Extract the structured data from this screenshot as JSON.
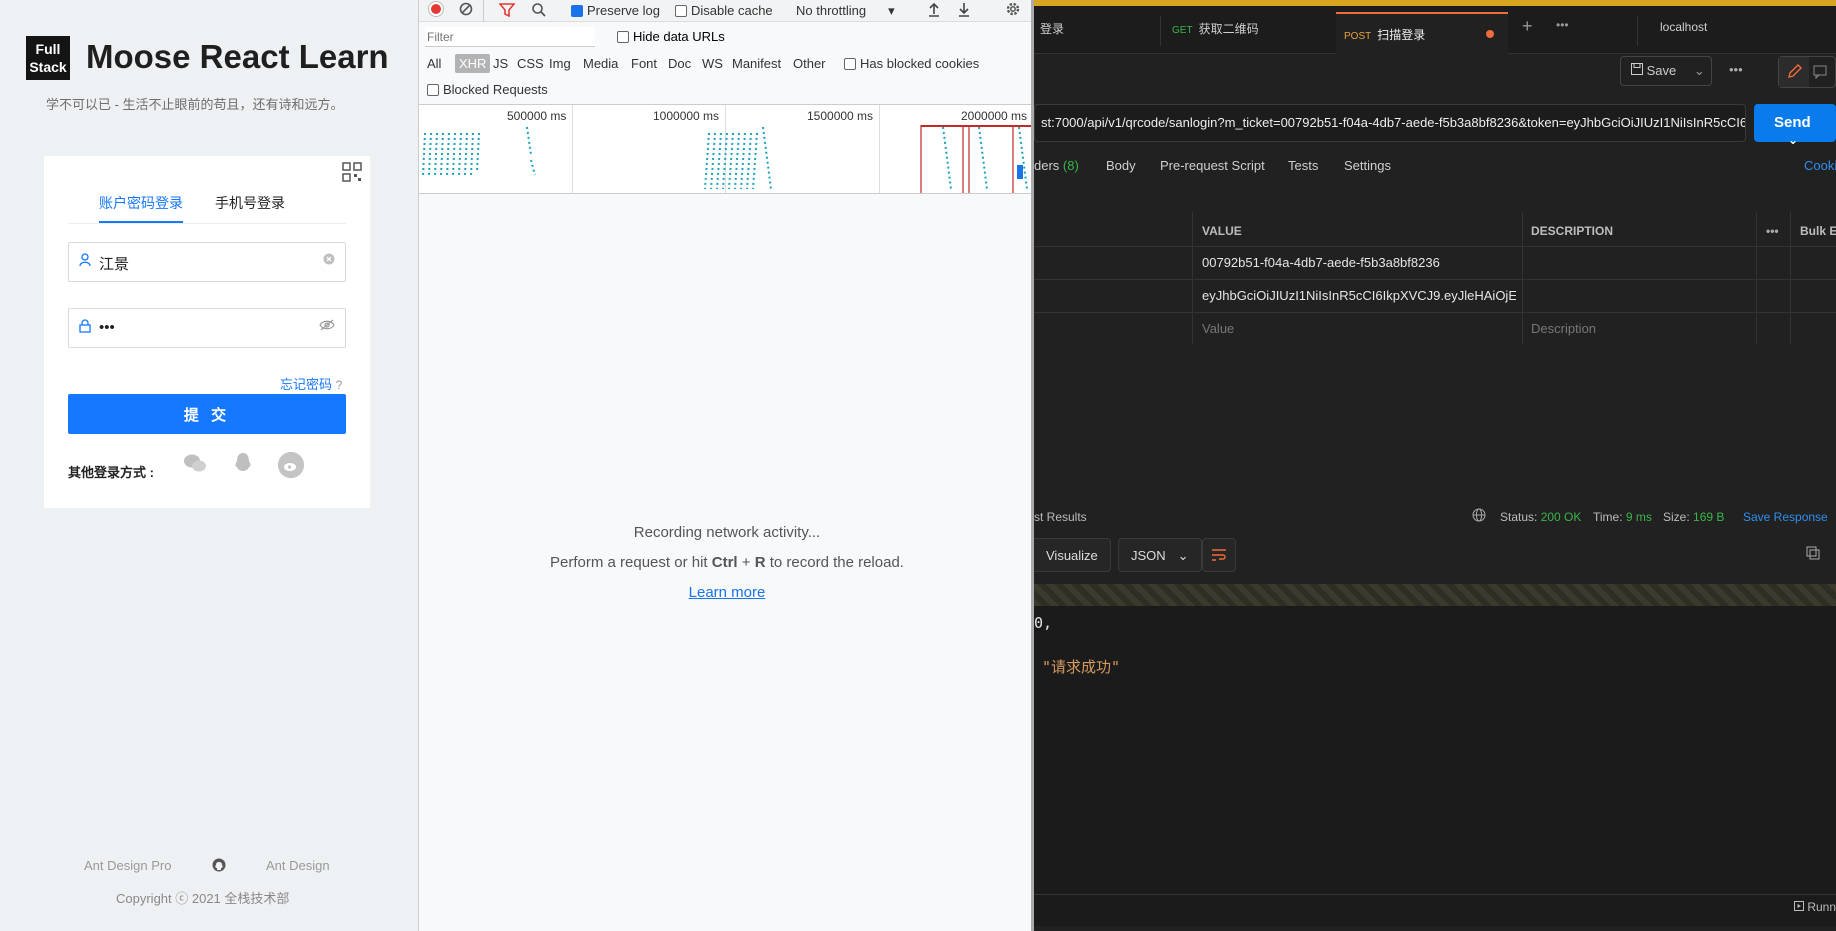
{
  "login": {
    "logo_line1": "Full",
    "logo_line2": "Stack",
    "title": "Moose React Learn",
    "slogan": "学不可以已 - 生活不止眼前的苟且，还有诗和远方。",
    "tab_account": "账户密码登录",
    "tab_phone": "手机号登录",
    "username_value": "江景",
    "password_value": "•••",
    "forgot_link": "忘记密码",
    "forgot_mark": "?",
    "submit_label": "提 交",
    "other_login_label": "其他登录方式 :",
    "footer_link_1": "Ant Design Pro",
    "footer_link_2": "Ant Design",
    "footer_copyright": "Copyright ⓒ 2021 全栈技术部",
    "accent_color": "#1677ff"
  },
  "devtools": {
    "preserve_log": "Preserve log",
    "disable_cache": "Disable cache",
    "throttling": "No throttling",
    "filter_placeholder": "Filter",
    "hide_data_urls": "Hide data URLs",
    "types": [
      "All",
      "XHR",
      "JS",
      "CSS",
      "Img",
      "Media",
      "Font",
      "Doc",
      "WS",
      "Manifest",
      "Other"
    ],
    "has_blocked_cookies": "Has blocked cookies",
    "blocked_requests": "Blocked Requests",
    "timeline_ticks": [
      "500000 ms",
      "1000000 ms",
      "1500000 ms",
      "2000000 ms"
    ],
    "empty_line_1": "Recording network activity...",
    "empty_line_2_prefix": "Perform a request or hit ",
    "empty_line_2_key1": "Ctrl",
    "empty_line_2_plus": " + ",
    "empty_line_2_key2": "R",
    "empty_line_2_suffix": " to record the reload.",
    "learn_more": "Learn more"
  },
  "postman": {
    "tab_1": "登录",
    "tab_2_method": "GET",
    "tab_2_label": "获取二维码",
    "tab_3_method": "POST",
    "tab_3_label": "扫描登录",
    "tab_4_label": "localhost",
    "tab_more": "•••",
    "save_label": "Save",
    "url": "st:7000/api/v1/qrcode/sanlogin?m_ticket=00792b51-f04a-4db7-aede-f5b3a8bf8236&token=eyJhbGciOiJIUzI1NiIsInR5cCI6I",
    "send_label": "Send",
    "req_tabs": {
      "headers": "ders",
      "headers_count": "(8)",
      "body": "Body",
      "prerequest": "Pre-request Script",
      "tests": "Tests",
      "settings": "Settings",
      "cookies": "Cooki"
    },
    "table_headers": {
      "value": "VALUE",
      "description": "DESCRIPTION",
      "bulk": "Bulk E"
    },
    "rows": [
      {
        "value": "00792b51-f04a-4db7-aede-f5b3a8bf8236",
        "description": ""
      },
      {
        "value": "eyJhbGciOiJIUzI1NiIsInR5cCI6IkpXVCJ9.eyJleHAiOjE2...",
        "description": ""
      },
      {
        "value": "Value",
        "description": "Description"
      }
    ],
    "test_results": "st Results",
    "status_label": "Status:",
    "status_value": "200 OK",
    "time_label": "Time:",
    "time_value": "9 ms",
    "size_label": "Size:",
    "size_value": "169 B",
    "save_response": "Save Response",
    "visualize": "Visualize",
    "format": "JSON",
    "code_line_1": "0,",
    "code_line_2": "\"请求成功\"",
    "runner": "Runn",
    "accent_send": "#097bed",
    "status_color": "#39b54a"
  }
}
